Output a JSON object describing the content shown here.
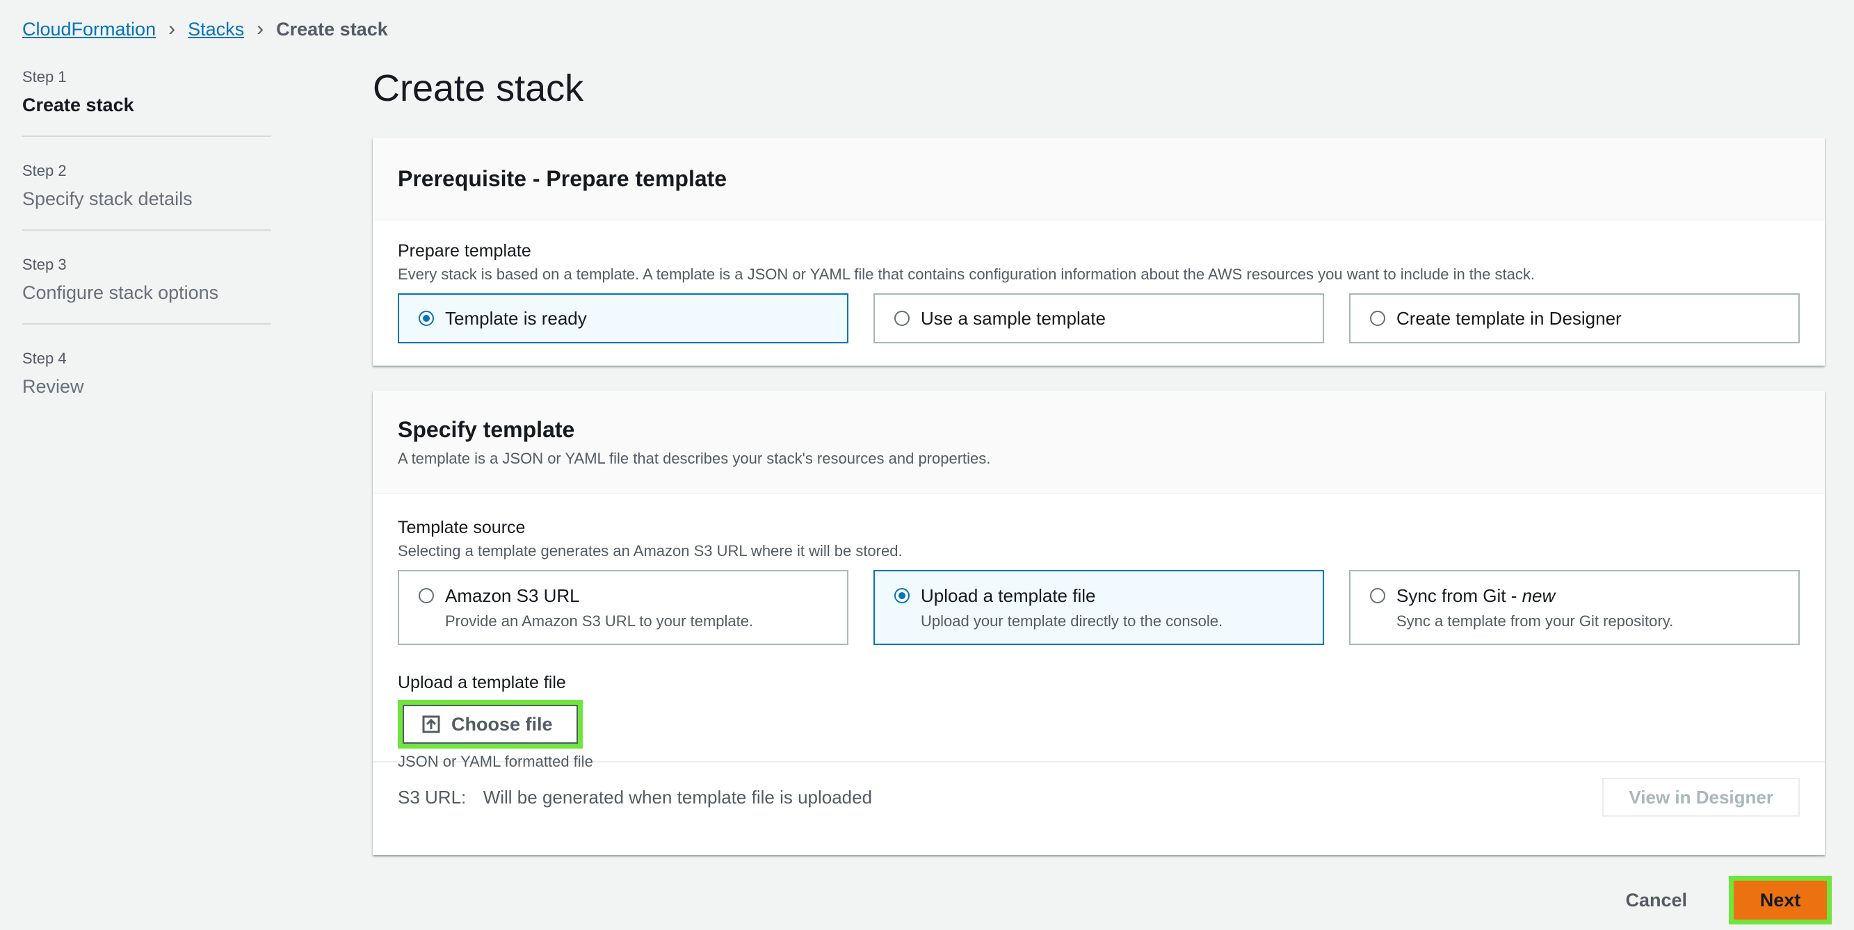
{
  "breadcrumb": {
    "items": [
      "CloudFormation",
      "Stacks"
    ],
    "current": "Create stack"
  },
  "steps": [
    {
      "num": "Step 1",
      "title": "Create stack"
    },
    {
      "num": "Step 2",
      "title": "Specify stack details"
    },
    {
      "num": "Step 3",
      "title": "Configure stack options"
    },
    {
      "num": "Step 4",
      "title": "Review"
    }
  ],
  "page": {
    "title": "Create stack"
  },
  "prerequisite": {
    "heading": "Prerequisite - Prepare template",
    "label": "Prepare template",
    "description": "Every stack is based on a template. A template is a JSON or YAML file that contains configuration information about the AWS resources you want to include in the stack.",
    "options": [
      {
        "label": "Template is ready",
        "selected": true
      },
      {
        "label": "Use a sample template",
        "selected": false
      },
      {
        "label": "Create template in Designer",
        "selected": false
      }
    ]
  },
  "specify": {
    "heading": "Specify template",
    "description": "A template is a JSON or YAML file that describes your stack's resources and properties.",
    "source_label": "Template source",
    "source_description": "Selecting a template generates an Amazon S3 URL where it will be stored.",
    "options": [
      {
        "label": "Amazon S3 URL",
        "desc": "Provide an Amazon S3 URL to your template.",
        "selected": false
      },
      {
        "label": "Upload a template file",
        "desc": "Upload your template directly to the console.",
        "selected": true
      },
      {
        "label": "Sync from Git - ",
        "label_em": "new",
        "desc": "Sync a template from your Git repository.",
        "selected": false
      }
    ],
    "upload_label": "Upload a template file",
    "choose_file": "Choose file",
    "file_hint": "JSON or YAML formatted file",
    "s3_key": "S3 URL:",
    "s3_value": "Will be generated when template file is uploaded",
    "view_designer": "View in Designer"
  },
  "footer": {
    "cancel": "Cancel",
    "next": "Next"
  },
  "colors": {
    "accent": "#0073bb",
    "primary_button": "#ec7211",
    "highlight": "#6fe53e"
  }
}
